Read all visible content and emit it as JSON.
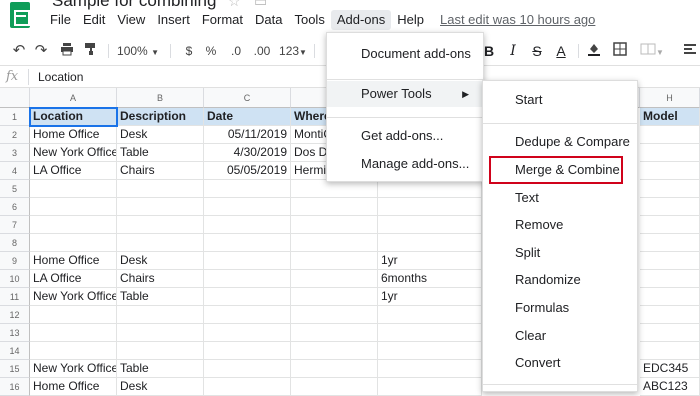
{
  "app": {
    "title": "Sample for combining",
    "last_edit": "Last edit was 10 hours ago",
    "menus": [
      "File",
      "Edit",
      "View",
      "Insert",
      "Format",
      "Data",
      "Tools",
      "Add-ons",
      "Help"
    ]
  },
  "toolbar": {
    "zoom": "100%",
    "currency": "$",
    "percent": "%",
    "decimal_decrease": ".0",
    "decimal_increase": ".00",
    "format_more": "123"
  },
  "formula": {
    "fx": "fx",
    "value": "Location"
  },
  "columns": [
    "A",
    "B",
    "C",
    "D",
    "H"
  ],
  "rows": [
    "1",
    "2",
    "3",
    "4",
    "5",
    "6",
    "7",
    "8",
    "9",
    "10",
    "11",
    "12",
    "13",
    "14",
    "15",
    "16"
  ],
  "cells": {
    "headers": {
      "a": "Location",
      "b": "Description",
      "c": "Date",
      "d": "Where",
      "h": "Model"
    },
    "r2": {
      "a": "Home Office",
      "b": "Desk",
      "c": "05/11/2019",
      "d": "MontiC"
    },
    "r3": {
      "a": "New York Office",
      "b": "Table",
      "c": "4/30/2019",
      "d": "Dos D"
    },
    "r4": {
      "a": "LA Office",
      "b": "Chairs",
      "c": "05/05/2019",
      "d": "Hermi"
    },
    "r9": {
      "a": "Home Office",
      "b": "Desk",
      "e": "1yr"
    },
    "r10": {
      "a": "LA Office",
      "b": "Chairs",
      "e": "6months"
    },
    "r11": {
      "a": "New York Office",
      "b": "Table",
      "e": "1yr"
    },
    "r15": {
      "a": "New York Office",
      "b": "Table",
      "h": "EDC345"
    },
    "r16": {
      "a": "Home Office",
      "b": "Desk",
      "h": "ABC123"
    }
  },
  "addons_menu": {
    "items": [
      "Document add-ons",
      "Power Tools",
      "Get add-ons...",
      "Manage add-ons..."
    ]
  },
  "power_tools_menu": {
    "items": [
      "Start",
      "Dedupe & Compare",
      "Merge & Combine",
      "Text",
      "Remove",
      "Split",
      "Randomize",
      "Formulas",
      "Clear",
      "Convert"
    ]
  },
  "colors": {
    "header_fill": "#cfe2f3",
    "selection": "#1a73e8",
    "highlight": "#d0021b",
    "sheets_green": "#0f9d58"
  }
}
